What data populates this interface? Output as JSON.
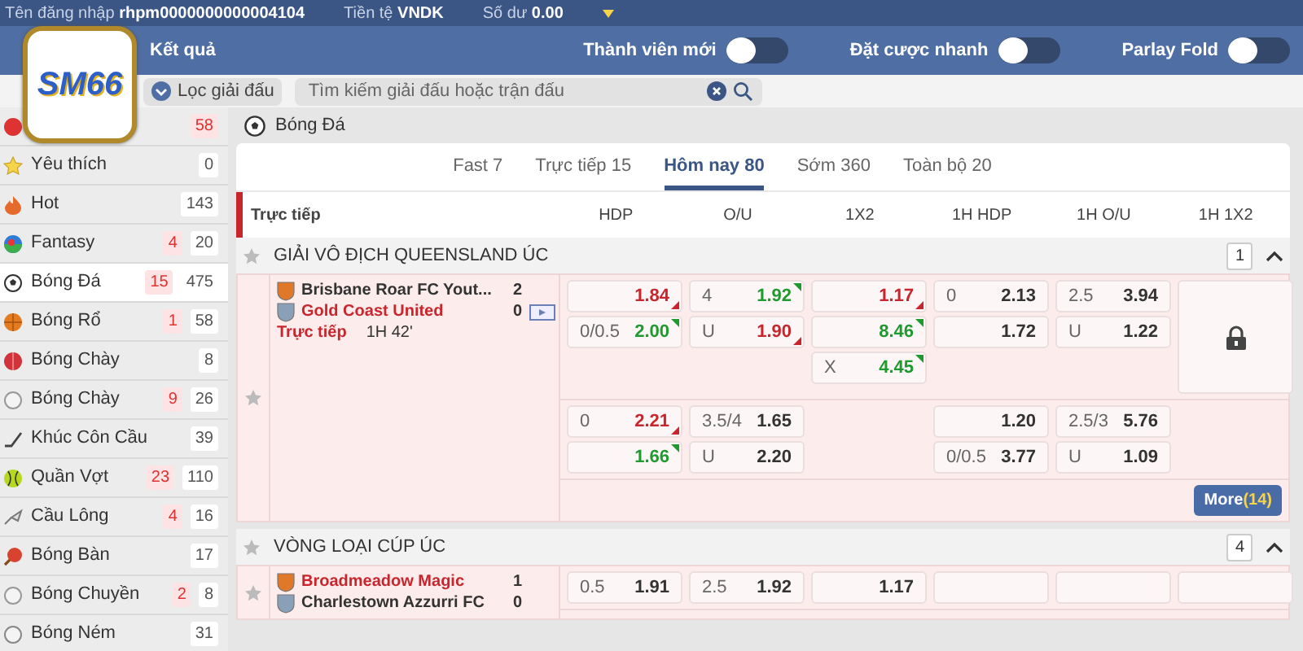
{
  "logo": {
    "text": "SM66"
  },
  "account": {
    "username_label": "Tên đăng nhập",
    "username": "rhpm0000000000004104",
    "currency_label": "Tiền tệ",
    "currency": "VNDK",
    "balance_label": "Số dư",
    "balance": "0.00"
  },
  "toolbar": {
    "results": "Kết quả",
    "toggles": [
      {
        "label": "Thành viên mới",
        "on": false
      },
      {
        "label": "Đặt cược nhanh",
        "on": false
      },
      {
        "label": "Parlay Fold",
        "on": false
      }
    ]
  },
  "filter": {
    "button": "Lọc giải đấu",
    "search_placeholder": "Tìm kiếm giải đấu hoặc trận đấu"
  },
  "sidebar": {
    "items": [
      {
        "live_count": "58",
        "selected": false
      },
      {
        "label": "Yêu thích",
        "count": "0",
        "selected": false
      },
      {
        "label": "Hot",
        "count": "143",
        "selected": false
      },
      {
        "label": "Fantasy",
        "live_count": "4",
        "count": "20",
        "selected": false
      },
      {
        "label": "Bóng Đá",
        "live_count": "15",
        "count": "475",
        "selected": true
      },
      {
        "label": "Bóng Rổ",
        "live_count": "1",
        "count": "58",
        "selected": false
      },
      {
        "label": "Bóng Chày",
        "count": "8",
        "selected": false
      },
      {
        "label": "Bóng Chày",
        "live_count": "9",
        "count": "26",
        "selected": false
      },
      {
        "label": "Khúc Côn Cầu",
        "count": "39",
        "selected": false
      },
      {
        "label": "Quần Vợt",
        "live_count": "23",
        "count": "110",
        "selected": false
      },
      {
        "label": "Cầu Lông",
        "live_count": "4",
        "count": "16",
        "selected": false
      },
      {
        "label": "Bóng Bàn",
        "count": "17",
        "selected": false
      },
      {
        "label": "Bóng Chuyền",
        "live_count": "2",
        "count": "8",
        "selected": false
      },
      {
        "label": "Bóng Ném",
        "count": "31",
        "selected": false
      }
    ]
  },
  "sport": {
    "title": "Bóng Đá"
  },
  "tabs": [
    {
      "label": "Fast 7",
      "selected": false
    },
    {
      "label": "Trực tiếp 15",
      "selected": false
    },
    {
      "label": "Hôm nay 80",
      "selected": true
    },
    {
      "label": "Sớm 360",
      "selected": false
    },
    {
      "label": "Toàn bộ 20",
      "selected": false
    }
  ],
  "header": {
    "section": "Trực tiếp",
    "markets": [
      "HDP",
      "O/U",
      "1X2",
      "1H HDP",
      "1H O/U",
      "1H 1X2"
    ]
  },
  "leagues": [
    {
      "name": "GIẢI VÔ ĐỊCH QUEENSLAND ÚC",
      "count": "1",
      "expanded": true,
      "matches": [
        {
          "home": {
            "name": "Brisbane Roar FC Yout...",
            "score": "2",
            "favorite": false
          },
          "away": {
            "name": "Gold Coast United",
            "score": "0",
            "favorite": true
          },
          "status": "Trực tiếp",
          "clock": "1H 42'",
          "line_groups": [
            {
              "markets": [
                {
                  "kind": "odds",
                  "cells": [
                    {
                      "price": "1.84",
                      "rising": false,
                      "falling": true
                    },
                    {
                      "line": "0/0.5",
                      "price": "2.00",
                      "rising": true,
                      "falling": false
                    }
                  ]
                },
                {
                  "kind": "odds",
                  "cells": [
                    {
                      "line": "4",
                      "price": "1.92",
                      "rising": true,
                      "falling": false
                    },
                    {
                      "line": "U",
                      "price": "1.90",
                      "rising": false,
                      "falling": true
                    }
                  ]
                },
                {
                  "kind": "odds",
                  "cells": [
                    {
                      "price": "1.17",
                      "rising": false,
                      "falling": true
                    },
                    {
                      "price": "8.46",
                      "rising": true,
                      "falling": false
                    },
                    {
                      "line": "X",
                      "price": "4.45",
                      "rising": true,
                      "falling": false
                    }
                  ]
                },
                {
                  "kind": "odds",
                  "cells": [
                    {
                      "line": "0",
                      "price": "2.13",
                      "rising": false,
                      "falling": false
                    },
                    {
                      "price": "1.72",
                      "rising": false,
                      "falling": false
                    }
                  ]
                },
                {
                  "kind": "odds",
                  "cells": [
                    {
                      "line": "2.5",
                      "price": "3.94",
                      "rising": false,
                      "falling": false
                    },
                    {
                      "line": "U",
                      "price": "1.22",
                      "rising": false,
                      "falling": false
                    }
                  ]
                },
                {
                  "kind": "locked"
                }
              ]
            },
            {
              "markets": [
                {
                  "kind": "odds",
                  "cells": [
                    {
                      "line": "0",
                      "price": "2.21",
                      "rising": false,
                      "falling": true
                    },
                    {
                      "price": "1.66",
                      "rising": true,
                      "falling": false
                    }
                  ]
                },
                {
                  "kind": "odds",
                  "cells": [
                    {
                      "line": "3.5/4",
                      "price": "1.65",
                      "rising": false,
                      "falling": false
                    },
                    {
                      "line": "U",
                      "price": "2.20",
                      "rising": false,
                      "falling": false
                    }
                  ]
                },
                {
                  "kind": "blank"
                },
                {
                  "kind": "odds",
                  "cells": [
                    {
                      "price": "1.20",
                      "rising": false,
                      "falling": false
                    },
                    {
                      "line": "0/0.5",
                      "price": "3.77",
                      "rising": false,
                      "falling": false
                    }
                  ]
                },
                {
                  "kind": "odds",
                  "cells": [
                    {
                      "line": "2.5/3",
                      "price": "5.76",
                      "rising": false,
                      "falling": false
                    },
                    {
                      "line": "U",
                      "price": "1.09",
                      "rising": false,
                      "falling": false
                    }
                  ]
                },
                {
                  "kind": "blank"
                }
              ]
            }
          ],
          "more": {
            "label": "More",
            "count": "(14)"
          }
        }
      ]
    },
    {
      "name": "VÒNG LOẠI CÚP ÚC",
      "count": "4",
      "expanded": true,
      "matches": [
        {
          "home": {
            "name": "Broadmeadow Magic",
            "score": "1",
            "favorite": true
          },
          "away": {
            "name": "Charlestown Azzurri FC",
            "score": "0",
            "favorite": false
          },
          "line_groups": [
            {
              "markets": [
                {
                  "kind": "odds",
                  "cells": [
                    {
                      "line": "0.5",
                      "price": "1.91",
                      "rising": false,
                      "falling": false
                    }
                  ]
                },
                {
                  "kind": "odds",
                  "cells": [
                    {
                      "line": "2.5",
                      "price": "1.92",
                      "rising": false,
                      "falling": false
                    }
                  ]
                },
                {
                  "kind": "odds",
                  "cells": [
                    {
                      "price": "1.17",
                      "rising": false,
                      "falling": false
                    }
                  ]
                },
                {
                  "kind": "placeholder"
                },
                {
                  "kind": "placeholder"
                },
                {
                  "kind": "placeholder"
                }
              ]
            }
          ]
        }
      ]
    }
  ]
}
